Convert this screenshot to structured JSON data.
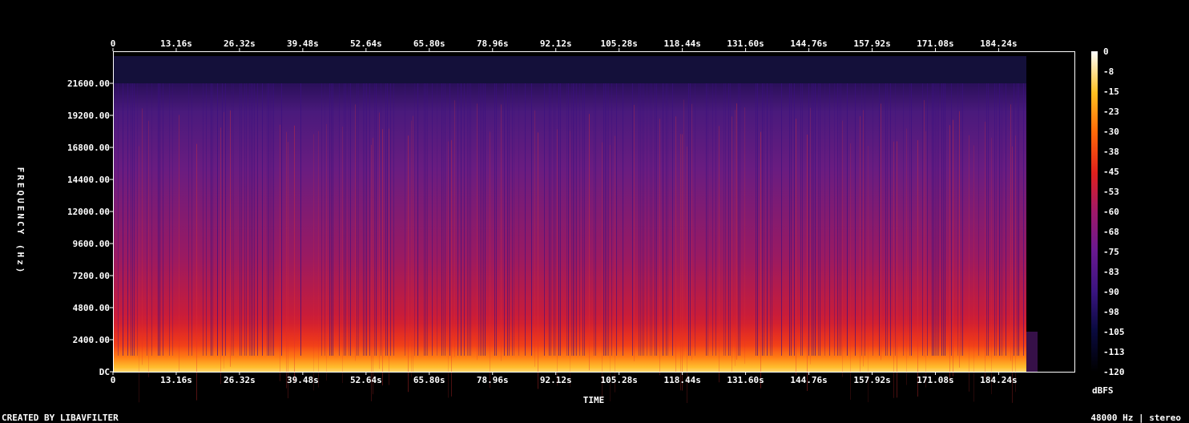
{
  "chart_data": {
    "type": "heatmap",
    "title": "",
    "xlabel": "TIME",
    "ylabel": "FREQUENCY (Hz)",
    "x_ticks": [
      "0",
      "13.16s",
      "26.32s",
      "39.48s",
      "52.64s",
      "65.80s",
      "78.96s",
      "92.12s",
      "105.28s",
      "118.44s",
      "131.60s",
      "144.76s",
      "157.92s",
      "171.08s",
      "184.24s"
    ],
    "x_tick_values": [
      0,
      13.16,
      26.32,
      39.48,
      52.64,
      65.8,
      78.96,
      92.12,
      105.28,
      118.44,
      131.6,
      144.76,
      157.92,
      171.08,
      184.24
    ],
    "xlim": [
      0,
      200
    ],
    "y_ticks": [
      "DC",
      "2400.00",
      "4800.00",
      "7200.00",
      "9600.00",
      "12000.00",
      "14400.00",
      "16800.00",
      "19200.00",
      "21600.00"
    ],
    "y_tick_values": [
      0,
      2400,
      4800,
      7200,
      9600,
      12000,
      14400,
      16800,
      19200,
      21600
    ],
    "ylim": [
      0,
      24000
    ],
    "colorbar": {
      "label": "dBFS",
      "ticks": [
        "0",
        "-8",
        "-15",
        "-23",
        "-30",
        "-38",
        "-45",
        "-53",
        "-60",
        "-68",
        "-75",
        "-83",
        "-90",
        "-98",
        "-105",
        "-113",
        "-120"
      ],
      "range": [
        -120,
        0
      ],
      "colormap": "intensity (black-navy-purple-red-orange-yellow-white)"
    },
    "signal_end_time": 190,
    "lowpass_cutoff_hz": 21600
  },
  "footer": {
    "left": "CREATED BY LIBAVFILTER",
    "right": "48000 Hz | stereo"
  },
  "colors": {
    "background": "#000000",
    "text": "#ffffff"
  }
}
